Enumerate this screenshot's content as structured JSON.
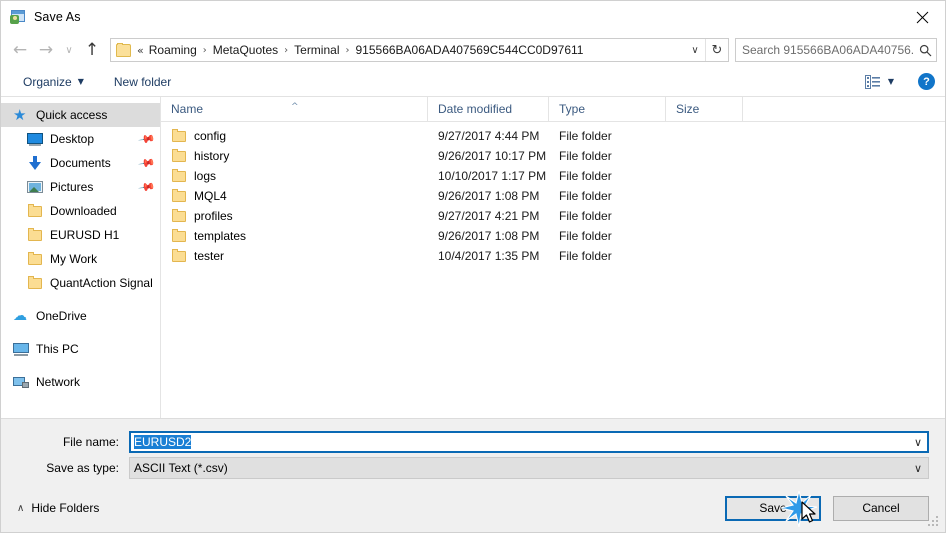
{
  "window": {
    "title": "Save As",
    "icon": "save-as-icon",
    "close_label": "✕"
  },
  "nav": {
    "back": "←",
    "forward": "→",
    "recent": "∨",
    "up": "↑",
    "breadcrumb_prefix": "«",
    "breadcrumb_sep": "›",
    "breadcrumbs": [
      "Roaming",
      "MetaQuotes",
      "Terminal",
      "915566BA06ADA407569C544CC0D97611"
    ],
    "address_dropdown": "∨",
    "refresh": "↻"
  },
  "search": {
    "placeholder": "Search 915566BA06ADA40756...",
    "icon": "search-icon"
  },
  "toolbar": {
    "organize_label": "Organize",
    "organize_caret": "▼",
    "new_folder_label": "New folder",
    "view_caret": "▼",
    "help_label": "?"
  },
  "sidebar": {
    "items": [
      {
        "label": "Quick access",
        "icon": "star-icon",
        "selected": true,
        "indent": false,
        "pinned": false
      },
      {
        "label": "Desktop",
        "icon": "desktop-icon",
        "selected": false,
        "indent": true,
        "pinned": true
      },
      {
        "label": "Documents",
        "icon": "documents-icon",
        "selected": false,
        "indent": true,
        "pinned": true
      },
      {
        "label": "Pictures",
        "icon": "pictures-icon",
        "selected": false,
        "indent": true,
        "pinned": true
      },
      {
        "label": "Downloaded",
        "icon": "folder-icon",
        "selected": false,
        "indent": true,
        "pinned": false
      },
      {
        "label": "EURUSD H1",
        "icon": "folder-icon",
        "selected": false,
        "indent": true,
        "pinned": false
      },
      {
        "label": "My Work",
        "icon": "folder-icon",
        "selected": false,
        "indent": true,
        "pinned": false
      },
      {
        "label": "QuantAction Signal",
        "icon": "folder-icon",
        "selected": false,
        "indent": true,
        "pinned": false
      },
      {
        "label": "OneDrive",
        "icon": "cloud-icon",
        "selected": false,
        "indent": false,
        "pinned": false
      },
      {
        "label": "This PC",
        "icon": "thispc-icon",
        "selected": false,
        "indent": false,
        "pinned": false
      },
      {
        "label": "Network",
        "icon": "network-icon",
        "selected": false,
        "indent": false,
        "pinned": false
      }
    ],
    "pin_glyph": "✒"
  },
  "file_list": {
    "columns": [
      "Name",
      "Date modified",
      "Type",
      "Size"
    ],
    "sort_indicator": "^",
    "rows": [
      {
        "name": "config",
        "date": "9/27/2017 4:44 PM",
        "type": "File folder",
        "size": ""
      },
      {
        "name": "history",
        "date": "9/26/2017 10:17 PM",
        "type": "File folder",
        "size": ""
      },
      {
        "name": "logs",
        "date": "10/10/2017 1:17 PM",
        "type": "File folder",
        "size": ""
      },
      {
        "name": "MQL4",
        "date": "9/26/2017 1:08 PM",
        "type": "File folder",
        "size": ""
      },
      {
        "name": "profiles",
        "date": "9/27/2017 4:21 PM",
        "type": "File folder",
        "size": ""
      },
      {
        "name": "templates",
        "date": "9/26/2017 1:08 PM",
        "type": "File folder",
        "size": ""
      },
      {
        "name": "tester",
        "date": "10/4/2017 1:35 PM",
        "type": "File folder",
        "size": ""
      }
    ]
  },
  "form": {
    "file_name_label": "File name:",
    "file_name_value": "EURUSD2",
    "save_as_type_label": "Save as type:",
    "save_as_type_value": "ASCII Text (*.csv)",
    "caret": "∨"
  },
  "footer": {
    "hide_folders_label": "Hide Folders",
    "hide_folders_caret": "∧",
    "save_label": "Save",
    "cancel_label": "Cancel"
  },
  "colors": {
    "accent": "#0a69b4",
    "selection": "#1a7fd4",
    "header_text": "#3b5a80",
    "toolbar_text": "#1e3c63",
    "folder": "#fbdd93",
    "sidebar_selected": "#dcdcdc"
  }
}
